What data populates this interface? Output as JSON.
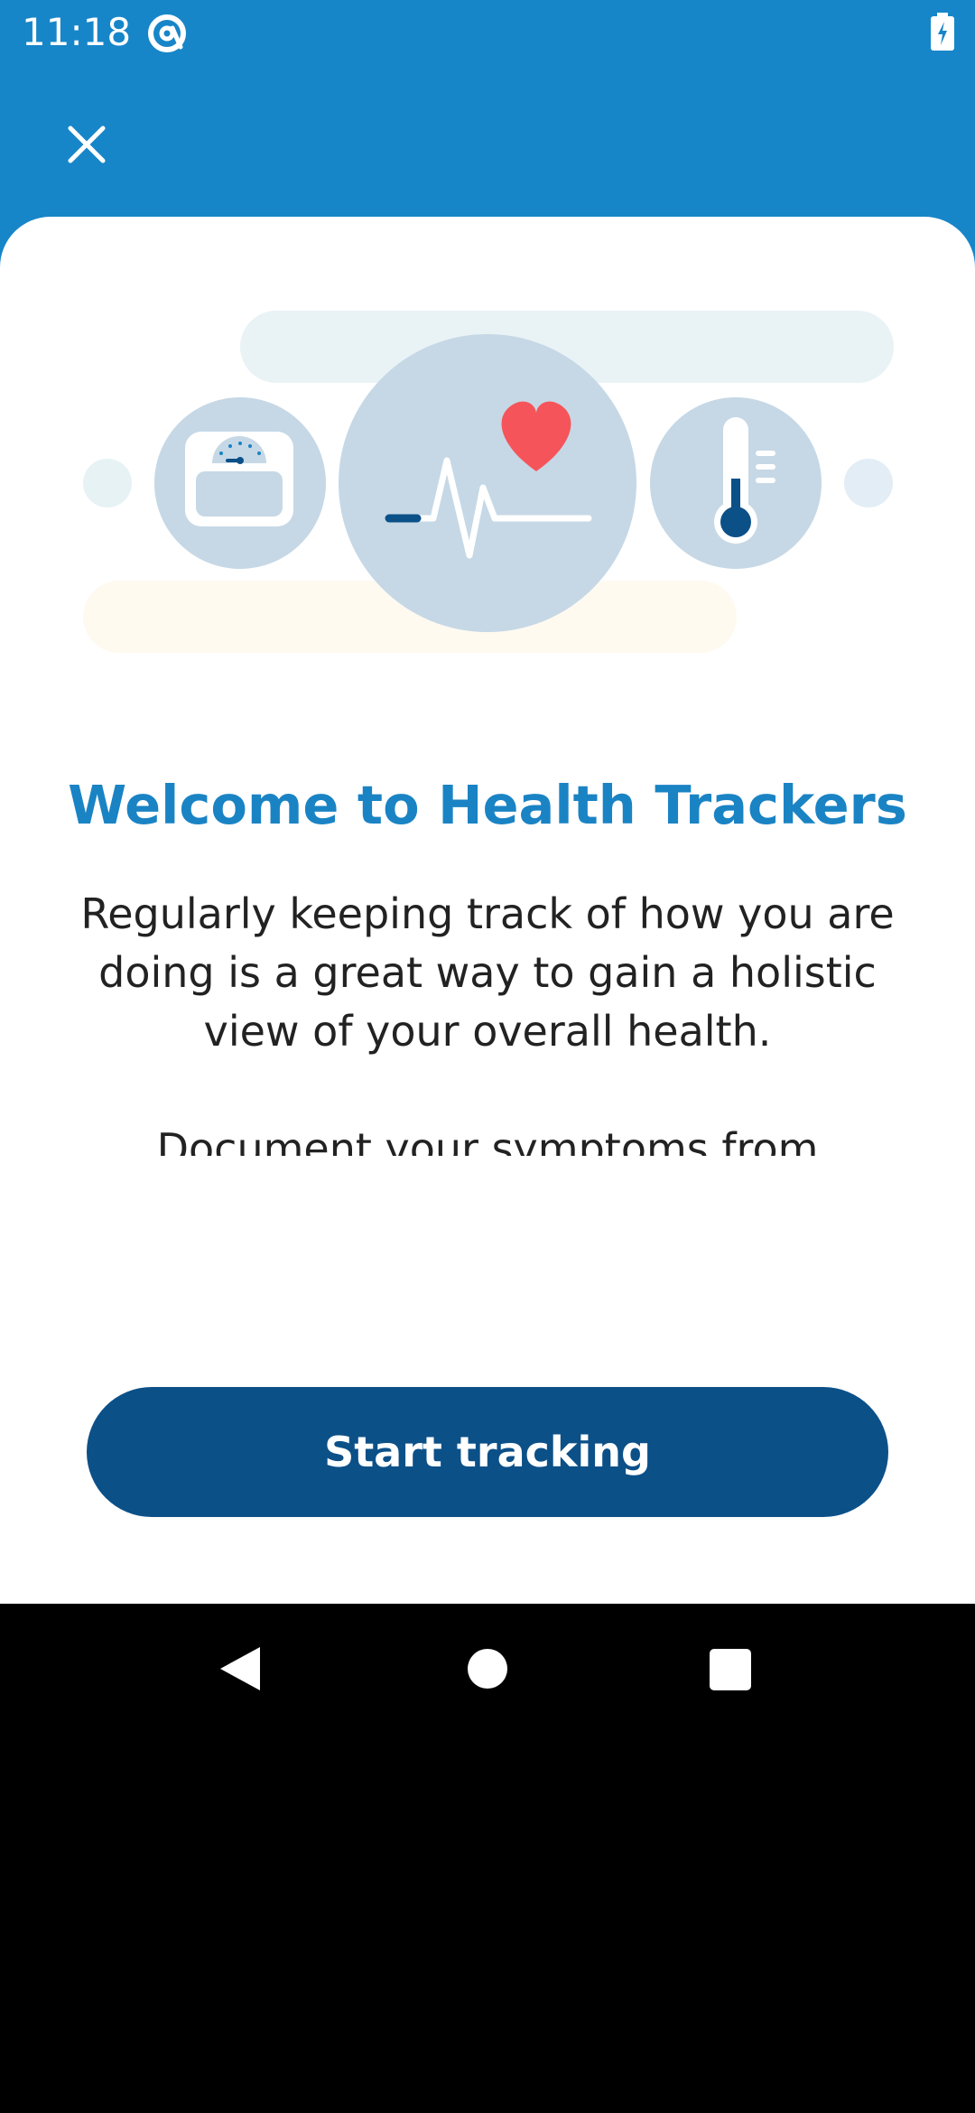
{
  "status_bar": {
    "time": "11:18",
    "icons": [
      "at-sign-icon",
      "battery-charging-icon"
    ]
  },
  "header": {
    "close_icon": "close-icon",
    "background_color": "#1786c8"
  },
  "illustration": {
    "icons": [
      "scale-icon",
      "heartbeat-icon",
      "heart-icon",
      "thermometer-icon"
    ]
  },
  "main": {
    "title": "Welcome to Health Trackers",
    "paragraphs": [
      "Regularly keeping track of how you are doing is a great way to gain a holistic view of your overall health.",
      "Document your symptoms from abdominal pain through heartburn, nausea, rashes, all the way to wheezing. Use daily, weekly, or monthly reminders to help you stay on track."
    ],
    "title_color": "#1a83c4"
  },
  "cta": {
    "label": "Start tracking",
    "color": "#0c5088"
  },
  "nav": {
    "icons": [
      "back-icon",
      "home-icon",
      "recents-icon"
    ]
  }
}
